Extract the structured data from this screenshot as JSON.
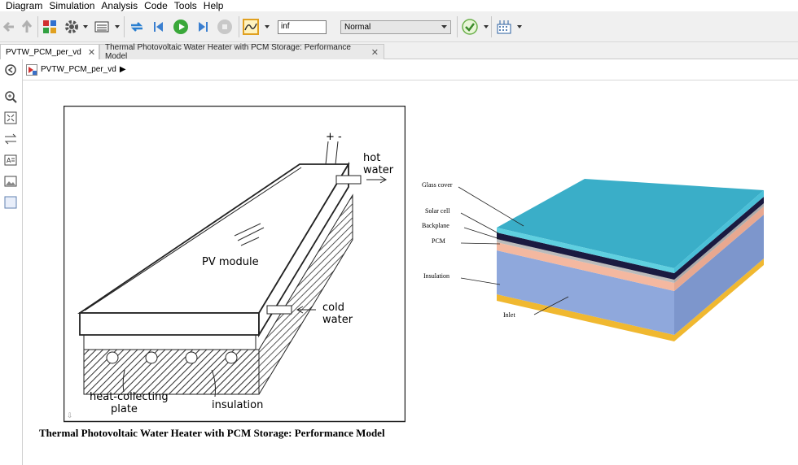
{
  "menu": [
    "Diagram",
    "Simulation",
    "Analysis",
    "Code",
    "Tools",
    "Help"
  ],
  "toolbar": {
    "stop_time": "inf",
    "sim_mode": "Normal",
    "icons": [
      "back-arrow-icon",
      "up-arrow-icon",
      "library-icon",
      "gear-icon",
      "model-explorer-icon",
      "update-diagram-icon",
      "step-back-icon",
      "run-icon",
      "step-forward-icon",
      "stop-icon",
      "scope-icon",
      "check-icon",
      "data-inspector-icon"
    ]
  },
  "tabs": [
    {
      "label": "PVTW_PCM_per_vd",
      "close": "✕"
    },
    {
      "label": "Thermal Photovoltaic Water Heater with PCM Storage: Performance Model",
      "close": "✕"
    }
  ],
  "breadcrumb": {
    "path": "PVTW_PCM_per_vd",
    "arrow": "▶"
  },
  "left_figure": {
    "plus_minus": "+ -",
    "hot_water_1": "hot",
    "hot_water_2": "water",
    "cold_water_1": "cold",
    "cold_water_2": "water",
    "pv_module": "PV module",
    "heat_plate_1": "heat-collecting",
    "heat_plate_2": "plate",
    "insulation": "insulation"
  },
  "right_figure": {
    "labels": [
      "Glass cover",
      "Solar cell",
      "Backplane",
      "PCM",
      "Insulation",
      "Inlet"
    ],
    "colors": {
      "glass": "#3aaec8",
      "cells": "#1a1a40",
      "backplane": "#bbbbbb",
      "pcm": "#f4b8a0",
      "insulation": "#8fa8dc",
      "base": "#f0b830"
    }
  },
  "caption": "Thermal Photovoltaic Water Heater with PCM Storage: Performance Model"
}
